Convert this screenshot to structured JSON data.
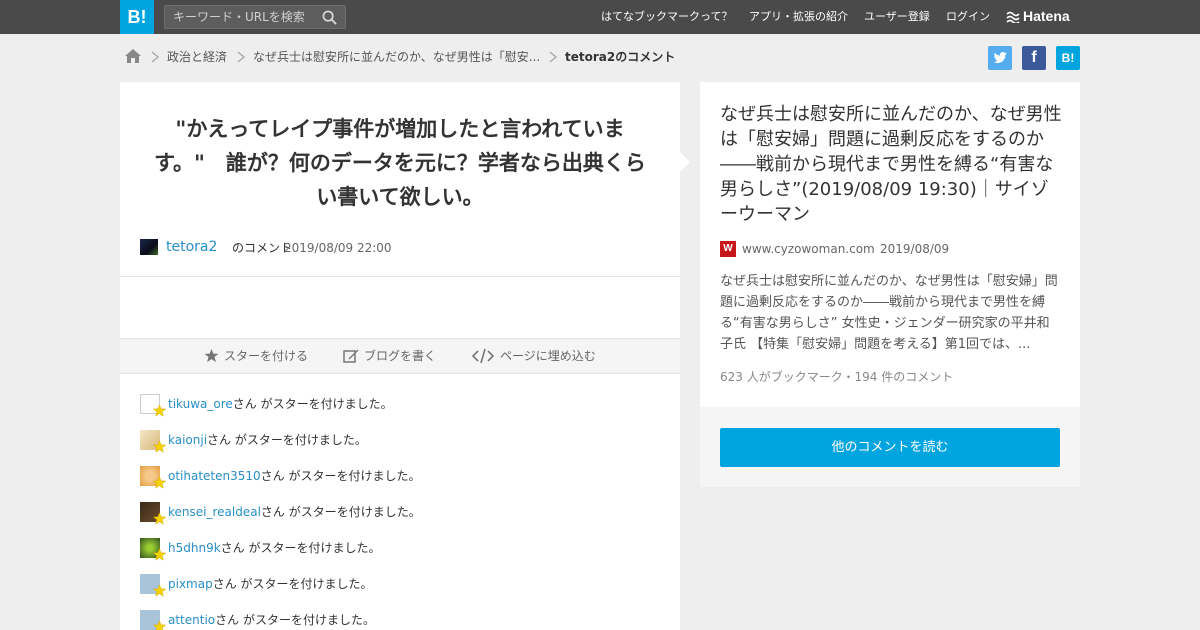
{
  "header": {
    "logo": "B!",
    "search_placeholder": "キーワード・URLを検索",
    "nav": [
      "はてなブックマークって？",
      "アプリ・拡張の紹介",
      "ユーザー登録",
      "ログイン"
    ],
    "brand": "Hatena"
  },
  "breadcrumb": {
    "category": "政治と経済",
    "entry": "なぜ兵士は慰安所に並んだのか、なぜ男性は「慰安...",
    "current": "tetora2のコメント"
  },
  "share": {
    "twitter": "t",
    "facebook": "f",
    "hatena": "B!"
  },
  "comment": {
    "text": "\"かえってレイプ事件が増加したと言われています。\"　誰が？何のデータを元に？学者なら出典くらい書いて欲しい。",
    "user": "tetora2",
    "user_suffix": "のコメント",
    "date": "2019/08/09 22:00"
  },
  "actions": {
    "star": "スターを付ける",
    "blog": "ブログを書く",
    "embed": "ページに埋め込む"
  },
  "stars": {
    "suffix": "さん がスターを付けました。",
    "users": [
      "tikuwa_ore",
      "kaionji",
      "otihateten3510",
      "kensei_realdeal",
      "h5dhn9k",
      "pixmap",
      "attentio"
    ]
  },
  "entry": {
    "title": "なぜ兵士は慰安所に並んだのか、なぜ男性は「慰安婦」問題に過剰反応をするのか――戦前から現代まで男性を縛る“有害な男らしさ”(2019/08/09 19:30)｜サイゾーウーマン",
    "favicon_letter": "W",
    "domain": "www.cyzowoman.com",
    "date": "2019/08/09",
    "summary": "なぜ兵士は慰安所に並んだのか、なぜ男性は「慰安婦」問題に過剰反応をするのか――戦前から現代まで男性を縛る“有害な男らしさ” 女性史・ジェンダー研究家の平井和子氏 【特集「慰安婦」問題を考える】第1回では、...",
    "stats": "623 人がブックマーク・194 件のコメント",
    "more_button": "他のコメントを読む"
  },
  "colors": {
    "accent": "#00a4de",
    "topbar": "#4a4a4a",
    "link": "#2a8fc8",
    "background": "#eeeeee"
  }
}
